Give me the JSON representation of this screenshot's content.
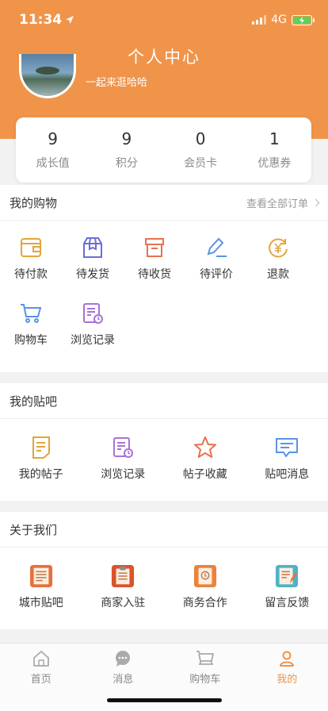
{
  "status": {
    "time": "11:34",
    "network": "4G"
  },
  "header": {
    "title": "个人中心",
    "slogan": "一起来逛哈哈"
  },
  "stats": [
    {
      "value": "9",
      "label": "成长值"
    },
    {
      "value": "9",
      "label": "积分"
    },
    {
      "value": "0",
      "label": "会员卡"
    },
    {
      "value": "1",
      "label": "优惠券"
    }
  ],
  "shopping": {
    "title": "我的购物",
    "view_all": "查看全部订单",
    "items": [
      {
        "label": "待付款",
        "icon": "wallet-icon"
      },
      {
        "label": "待发货",
        "icon": "package-icon"
      },
      {
        "label": "待收货",
        "icon": "box-icon"
      },
      {
        "label": "待评价",
        "icon": "pen-icon"
      },
      {
        "label": "退款",
        "icon": "refund-icon"
      },
      {
        "label": "购物车",
        "icon": "cart-icon"
      },
      {
        "label": "浏览记录",
        "icon": "history-icon"
      }
    ]
  },
  "tieba": {
    "title": "我的贴吧",
    "items": [
      {
        "label": "我的帖子",
        "icon": "post-icon"
      },
      {
        "label": "浏览记录",
        "icon": "history-icon"
      },
      {
        "label": "帖子收藏",
        "icon": "star-icon"
      },
      {
        "label": "贴吧消息",
        "icon": "message-icon"
      }
    ]
  },
  "about": {
    "title": "关于我们",
    "items": [
      {
        "label": "城市贴吧",
        "icon": "city-notebook-icon"
      },
      {
        "label": "商家入驻",
        "icon": "clipboard-icon"
      },
      {
        "label": "商务合作",
        "icon": "contacts-icon"
      },
      {
        "label": "留言反馈",
        "icon": "feedback-icon"
      }
    ]
  },
  "tabs": [
    {
      "label": "首页",
      "icon": "home-icon"
    },
    {
      "label": "消息",
      "icon": "chat-icon"
    },
    {
      "label": "购物车",
      "icon": "cart-icon"
    },
    {
      "label": "我的",
      "icon": "user-icon"
    }
  ],
  "colors": {
    "brand": "#f0944a",
    "background": "#f2f2f2"
  }
}
